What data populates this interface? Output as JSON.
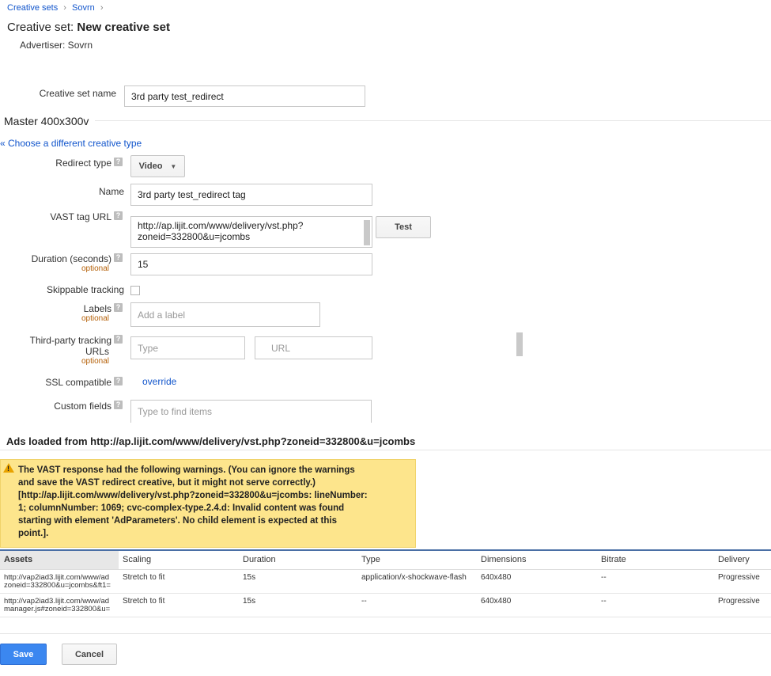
{
  "breadcrumb": {
    "items": [
      "Creative sets",
      "Sovrn"
    ],
    "separator": "›"
  },
  "page": {
    "title_prefix": "Creative set: ",
    "title_name": "New creative set",
    "advertiser": "Advertiser: Sovrn"
  },
  "creative_set_name": {
    "label": "Creative set name",
    "value": "3rd party test_redirect"
  },
  "master": {
    "title": "Master 400x300v",
    "choose_link": "« Choose a different creative type"
  },
  "form": {
    "redirect_type": {
      "label": "Redirect type",
      "value": "Video"
    },
    "name": {
      "label": "Name",
      "value": "3rd party test_redirect tag"
    },
    "vast_tag_url": {
      "label": "VAST tag URL",
      "value_line1": "http://ap.lijit.com/www/delivery/vst.php?",
      "value_line2": "zoneid=332800&u=jcombs",
      "test_label": "Test"
    },
    "duration": {
      "label": "Duration (seconds)",
      "optional": "optional",
      "value": "15"
    },
    "skippable": {
      "label": "Skippable tracking"
    },
    "labels": {
      "label": "Labels",
      "optional": "optional",
      "placeholder": "Add a label"
    },
    "third_party": {
      "label_line1": "Third-party tracking",
      "label_line2": "URLs",
      "optional": "optional",
      "type_placeholder": "Type",
      "url_placeholder": "URL"
    },
    "ssl": {
      "label": "SSL compatible",
      "override": "override"
    },
    "custom_fields": {
      "label": "Custom fields",
      "placeholder": "Type to find items"
    },
    "help_glyph": "?"
  },
  "ads_loaded": {
    "title": "Ads loaded from http://ap.lijit.com/www/delivery/vst.php?zoneid=332800&u=jcombs"
  },
  "warning": {
    "icon_glyph": "!",
    "lines": [
      "The VAST response had the following warnings. (You can ignore the warnings",
      "and save the VAST redirect creative, but it might not serve correctly.)",
      "[http://ap.lijit.com/www/delivery/vst.php?zoneid=332800&u=jcombs: lineNumber:",
      "1; columnNumber: 1069; cvc-complex-type.2.4.d: Invalid content was found",
      "starting with element 'AdParameters'. No child element is expected at this",
      "point.]."
    ]
  },
  "table": {
    "headers": [
      "Assets",
      "Scaling",
      "Duration",
      "Type",
      "Dimensions",
      "Bitrate",
      "Delivery"
    ],
    "rows": [
      {
        "asset_line1": "http://vap2iad3.lijit.com/www/ad",
        "asset_line2": "zoneid=332800&u=jcombs&ft1=",
        "scaling": "Stretch to fit",
        "duration": "15s",
        "type": "application/x-shockwave-flash",
        "dimensions": "640x480",
        "bitrate": "--",
        "delivery": "Progressive"
      },
      {
        "asset_line1": "http://vap2iad3.lijit.com/www/ad",
        "asset_line2": "manager.js#zoneid=332800&u=",
        "scaling": "Stretch to fit",
        "duration": "15s",
        "type": "--",
        "dimensions": "640x480",
        "bitrate": "--",
        "delivery": "Progressive"
      }
    ]
  },
  "actions": {
    "save": "Save",
    "cancel": "Cancel"
  }
}
